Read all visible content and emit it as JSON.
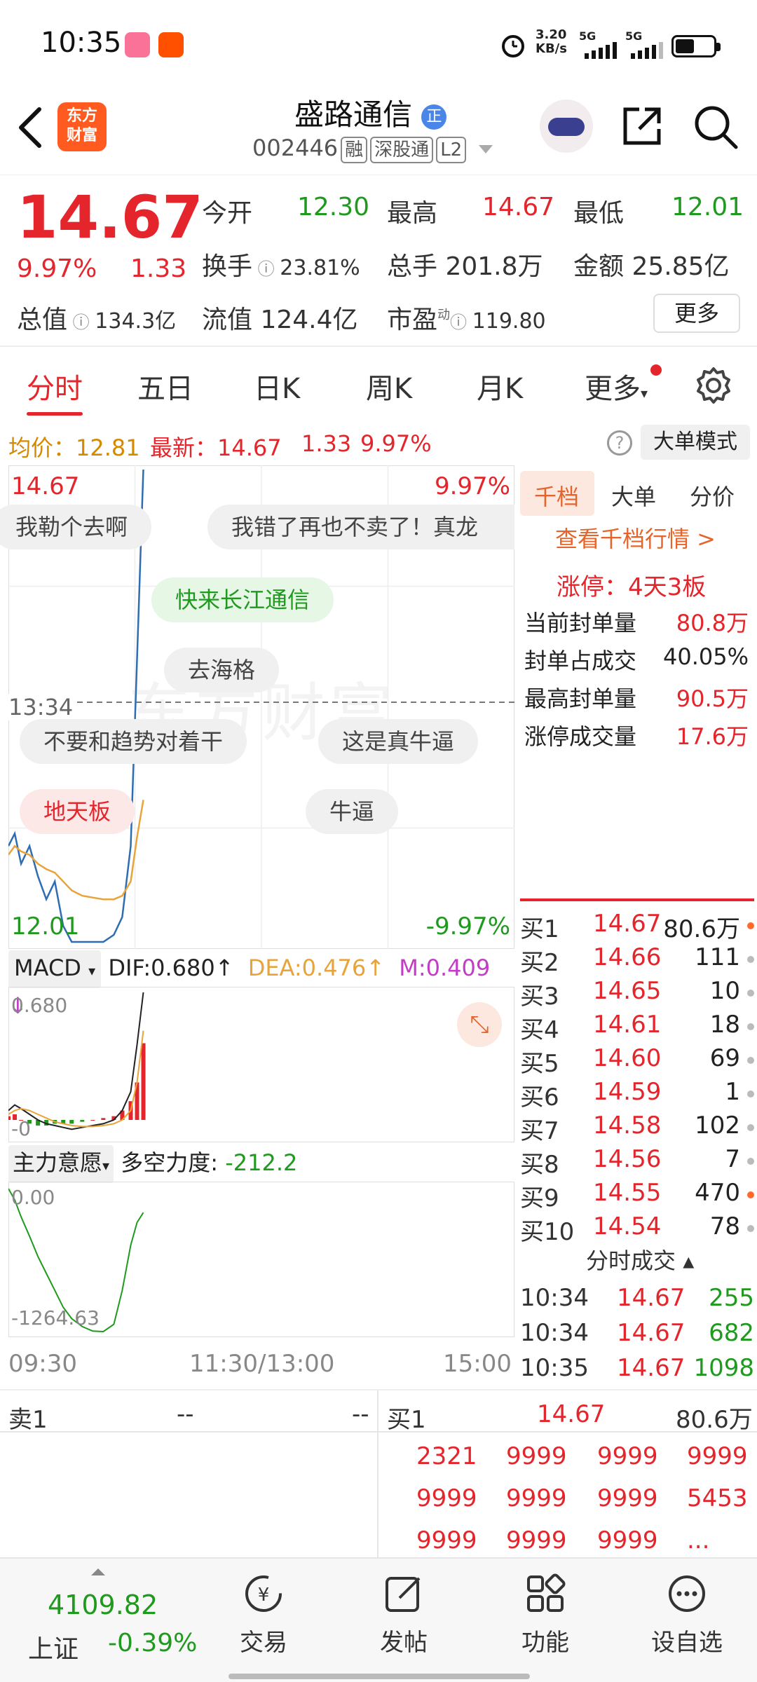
{
  "status_bar": {
    "time": "10:35",
    "net_speed": "3.20",
    "net_unit": "KB/s",
    "sig1": "5G",
    "sig2": "5G"
  },
  "header": {
    "logo_text_1": "东方",
    "logo_text_2": "财富",
    "stock_name": "盛路通信",
    "badge": "正",
    "stock_code": "002446",
    "tags": [
      "融",
      "深股通",
      "L2"
    ]
  },
  "quote": {
    "price": "14.67",
    "pct": "9.97%",
    "change": "1.33",
    "open_label": "今开",
    "open": "12.30",
    "high_label": "最高",
    "high": "14.67",
    "low_label": "最低",
    "low": "12.01",
    "turnover_label": "换手",
    "turnover": "23.81%",
    "volume_label": "总手",
    "volume": "201.8万",
    "amount_label": "金额",
    "amount": "25.85亿",
    "mktcap_label": "总值",
    "mktcap": "134.3亿",
    "float_label": "流值",
    "float": "124.4亿",
    "pe_label": "市盈",
    "pe_sup": "动",
    "pe": "119.80",
    "more": "更多"
  },
  "tabs": [
    "分时",
    "五日",
    "日K",
    "周K",
    "月K",
    "更多"
  ],
  "strip": {
    "avg": "均价：12.81",
    "latest": "最新：14.67",
    "chg": "1.33",
    "pct": "9.97%",
    "mode": "大单模式"
  },
  "chart": {
    "top_price": "14.67",
    "top_pct": "9.97%",
    "bottom_price": "12.01",
    "bottom_pct": "-9.97%",
    "cursor_time": "13:34",
    "watermark": "东方财富",
    "bubbles": [
      "我勒个去啊",
      "我错了再也不卖了！真龙",
      "快来长江通信",
      "去海格",
      "不要和趋势对着干",
      "这是真牛逼",
      "地天板",
      "牛逼"
    ],
    "macd_label": "MACD",
    "dif": "DIF:0.680",
    "dea": "DEA:0.476",
    "m": "M:0.409",
    "macd_top": "0.680",
    "macd_bottom": "-0",
    "zl_label": "主力意愿",
    "dk_label": "多空力度:",
    "dk_value": "-212.2",
    "zl_top": "0.00",
    "zl_bottom": "-1264.63",
    "time_start": "09:30",
    "time_mid": "11:30/13:00",
    "time_end": "15:00"
  },
  "chart_data": {
    "type": "line",
    "title": "",
    "x": [
      "09:30",
      "09:33",
      "09:36",
      "09:40",
      "09:44",
      "09:48",
      "09:52",
      "09:56",
      "10:00",
      "10:05",
      "10:10",
      "10:15",
      "10:20",
      "10:24",
      "10:28",
      "10:31",
      "10:34"
    ],
    "series": [
      {
        "values": [
          12.55,
          12.62,
          12.45,
          12.55,
          12.38,
          12.25,
          12.35,
          12.1,
          12.01,
          12.01,
          12.01,
          12.01,
          12.05,
          12.15,
          12.55,
          13.6,
          14.67
        ]
      },
      {
        "values": [
          12.5,
          12.55,
          12.52,
          12.5,
          12.45,
          12.42,
          12.4,
          12.35,
          12.3,
          12.27,
          12.26,
          12.25,
          12.25,
          12.27,
          12.35,
          12.6,
          12.81
        ]
      }
    ],
    "ylim": [
      12.01,
      14.67
    ],
    "colors": {
      "price": "#2f6db3",
      "avg": "#e8a43a"
    }
  },
  "macd_chart_data": {
    "type": "bar",
    "dif": [
      0.05,
      0.08,
      0.06,
      0.03,
      0.0,
      -0.02,
      -0.03,
      -0.04,
      -0.05,
      -0.04,
      -0.03,
      -0.02,
      0.0,
      0.05,
      0.15,
      0.4,
      0.68
    ],
    "dea": [
      0.03,
      0.05,
      0.06,
      0.05,
      0.03,
      0.01,
      -0.01,
      -0.02,
      -0.03,
      -0.035,
      -0.035,
      -0.03,
      -0.02,
      0.0,
      0.05,
      0.2,
      0.476
    ],
    "m": [
      0.02,
      0.03,
      0.0,
      -0.02,
      -0.03,
      -0.03,
      -0.02,
      -0.02,
      -0.02,
      -0.01,
      0.0,
      0.01,
      0.02,
      0.05,
      0.1,
      0.2,
      0.409
    ]
  },
  "zl_chart_data": {
    "type": "line",
    "values": [
      0,
      -100,
      -250,
      -420,
      -600,
      -750,
      -900,
      -1050,
      -1150,
      -1220,
      -1260,
      -1264.63,
      -1200,
      -900,
      -500,
      -300,
      -212.2
    ]
  },
  "right_panel": {
    "tabs": [
      "千档",
      "大单",
      "分价"
    ],
    "view_link": "查看千档行情 >",
    "limit_up": "涨停：4天3板",
    "rows": [
      {
        "label": "当前封单量",
        "value": "80.8万"
      },
      {
        "label": "封单占成交",
        "value": "40.05%"
      },
      {
        "label": "最高封单量",
        "value": "90.5万"
      },
      {
        "label": "涨停成交量",
        "value": "17.6万"
      }
    ],
    "order_book": [
      {
        "label": "买1",
        "price": "14.67",
        "vol": "80.6万"
      },
      {
        "label": "买2",
        "price": "14.66",
        "vol": "111"
      },
      {
        "label": "买3",
        "price": "14.65",
        "vol": "10"
      },
      {
        "label": "买4",
        "price": "14.61",
        "vol": "18"
      },
      {
        "label": "买5",
        "price": "14.60",
        "vol": "69"
      },
      {
        "label": "买6",
        "price": "14.59",
        "vol": "1"
      },
      {
        "label": "买7",
        "price": "14.58",
        "vol": "102"
      },
      {
        "label": "买8",
        "price": "14.56",
        "vol": "7"
      },
      {
        "label": "买9",
        "price": "14.55",
        "vol": "470"
      },
      {
        "label": "买10",
        "price": "14.54",
        "vol": "78"
      }
    ],
    "trades_title": "分时成交",
    "trades": [
      {
        "time": "10:34",
        "price": "14.67",
        "vol": "255"
      },
      {
        "time": "10:34",
        "price": "14.67",
        "vol": "682"
      },
      {
        "time": "10:35",
        "price": "14.67",
        "vol": "1098"
      }
    ]
  },
  "queue": {
    "sell_label": "卖1",
    "sell_price": "--",
    "sell_vol": "--",
    "buy_label": "买1",
    "buy_price": "14.67",
    "buy_vol": "80.6万",
    "cells": [
      "2321",
      "9999",
      "9999",
      "9999",
      "9999",
      "9999",
      "9999",
      "5453",
      "9999",
      "9999",
      "9999",
      "..."
    ]
  },
  "nav": {
    "index_value": "4109.82",
    "index_name": "上证",
    "index_pct": "-0.39%",
    "items": [
      "交易",
      "发帖",
      "功能",
      "设自选"
    ]
  }
}
